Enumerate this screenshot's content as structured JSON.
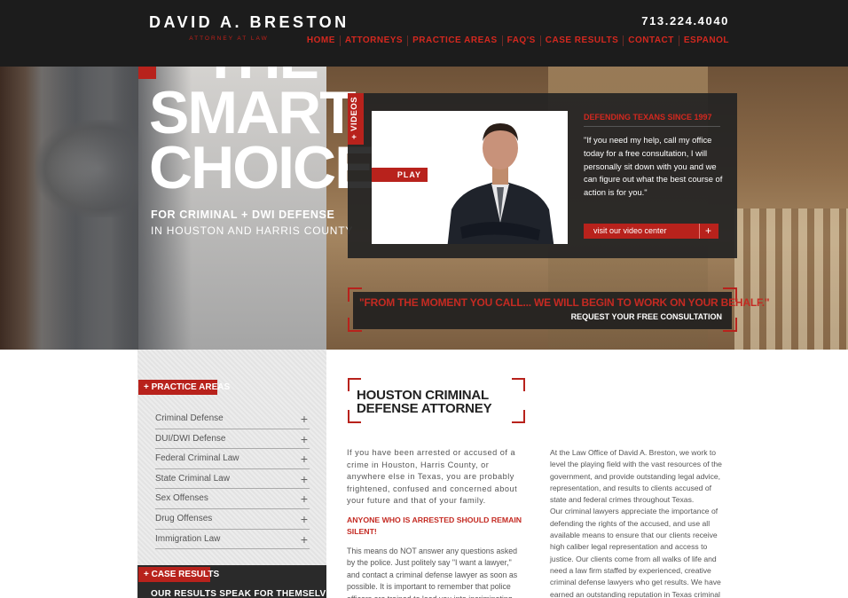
{
  "header": {
    "logo_name": "DAVID A. BRESTON",
    "logo_sub": "ATTORNEY AT LAW",
    "phone": "713.224.4040",
    "nav": [
      "HOME",
      "ATTORNEYS",
      "PRACTICE AREAS",
      "FAQ'S",
      "CASE RESULTS",
      "CONTACT",
      "ESPANOL"
    ]
  },
  "hero": {
    "headline_1": "THE",
    "headline_2": "SMART",
    "headline_3": "CHOICE",
    "tagline_1": "FOR CRIMINAL + DWI DEFENSE",
    "tagline_2": "IN HOUSTON AND HARRIS COUNTY",
    "videos_tab": "+ VIDEOS",
    "play_label": "PLAY",
    "since": "DEFENDING TEXANS SINCE 1997",
    "quote": "\"If you need my help, call my office today for a free consultation, I will personally sit down with you and we can figure out what the best course of action is for you.\"",
    "video_center_label": "visit our video center",
    "video_center_plus": "+",
    "banner_quote": "\"FROM THE MOMENT YOU CALL... WE WILL BEGIN TO WORK ON YOUR BEHALF.\"",
    "banner_cta": "REQUEST YOUR FREE CONSULTATION"
  },
  "sidebar": {
    "practice_title": "+ PRACTICE AREAS",
    "practice_items": [
      {
        "label": "Criminal Defense",
        "plus": "+"
      },
      {
        "label": "DUI/DWI Defense",
        "plus": "+"
      },
      {
        "label": "Federal Criminal Law",
        "plus": "+"
      },
      {
        "label": "State Criminal Law",
        "plus": "+"
      },
      {
        "label": "Sex Offenses",
        "plus": "+"
      },
      {
        "label": "Drug Offenses",
        "plus": "+"
      },
      {
        "label": "Immigration Law",
        "plus": "+"
      }
    ],
    "case_results_title": "+ CASE RESULTS",
    "case_results_text": "OUR RESULTS SPEAK FOR THEMSELVES"
  },
  "main": {
    "title_line_1": "HOUSTON CRIMINAL",
    "title_line_2": "DEFENSE ATTORNEY",
    "col1_p1": "If you have been arrested or accused of a crime in Houston, Harris County, or anywhere else in Texas, you are probably frightened, confused and concerned about your future and that of your family.",
    "col1_warning": "ANYONE WHO IS ARRESTED SHOULD REMAIN SILENT!",
    "col1_p2": "This means do NOT answer any questions asked by the police. Just politely say \"I want a lawyer,\" and contact a criminal defense lawyer as soon as possible. It is important to remember that police officers are trained to lead you into incriminating statements",
    "col2_p1": "At the Law Office of David A. Breston, we work to level the playing field with the vast resources of the government, and provide outstanding legal advice, representation, and results to clients accused of state and federal crimes throughout Texas.",
    "col2_p2": "Our criminal lawyers appreciate the importance of defending the rights of the accused, and use all available means to ensure that our clients receive high caliber legal representation and access to justice. Our clients come from all walks of life and need a law firm staffed by experienced, creative criminal defense lawyers who get results. We have earned an outstanding reputation in Texas criminal law circles"
  }
}
